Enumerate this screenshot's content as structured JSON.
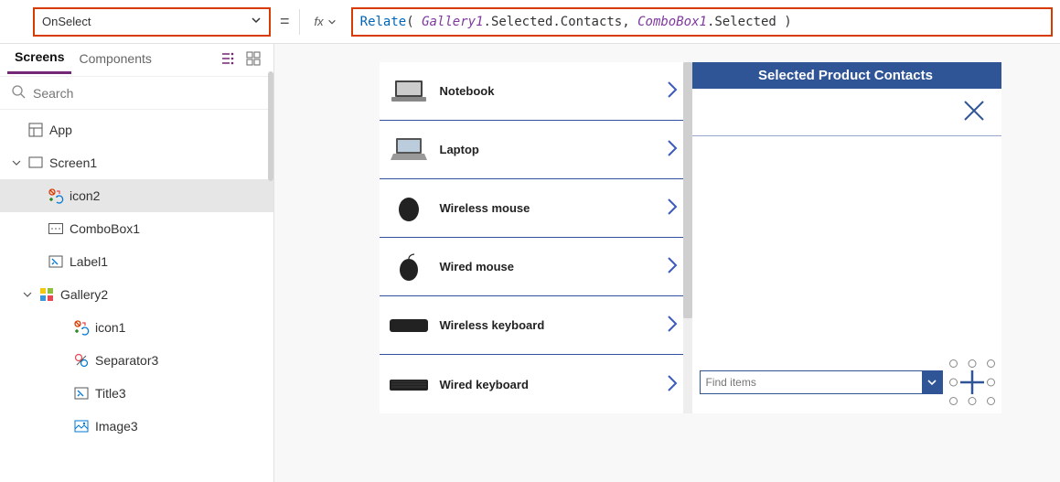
{
  "formula_bar": {
    "property": "OnSelect",
    "equals": "=",
    "fx_label": "fx",
    "tokens": {
      "func": "Relate",
      "open": "( ",
      "ident1": "Gallery1",
      "after1": ".Selected.Contacts, ",
      "ident2": "ComboBox1",
      "after2": ".Selected )"
    }
  },
  "left_panel": {
    "tabs": {
      "screens": "Screens",
      "components": "Components"
    },
    "search_placeholder": "Search",
    "tree": {
      "app": "App",
      "screen1": "Screen1",
      "icon2": "icon2",
      "combobox1": "ComboBox1",
      "label1": "Label1",
      "gallery2": "Gallery2",
      "icon1": "icon1",
      "separator3": "Separator3",
      "title3": "Title3",
      "image3": "Image3"
    }
  },
  "canvas": {
    "gallery_items": [
      "Notebook",
      "Laptop",
      "Wireless mouse",
      "Wired mouse",
      "Wireless keyboard",
      "Wired keyboard"
    ],
    "right": {
      "header": "Selected Product Contacts",
      "combo_placeholder": "Find items"
    }
  }
}
